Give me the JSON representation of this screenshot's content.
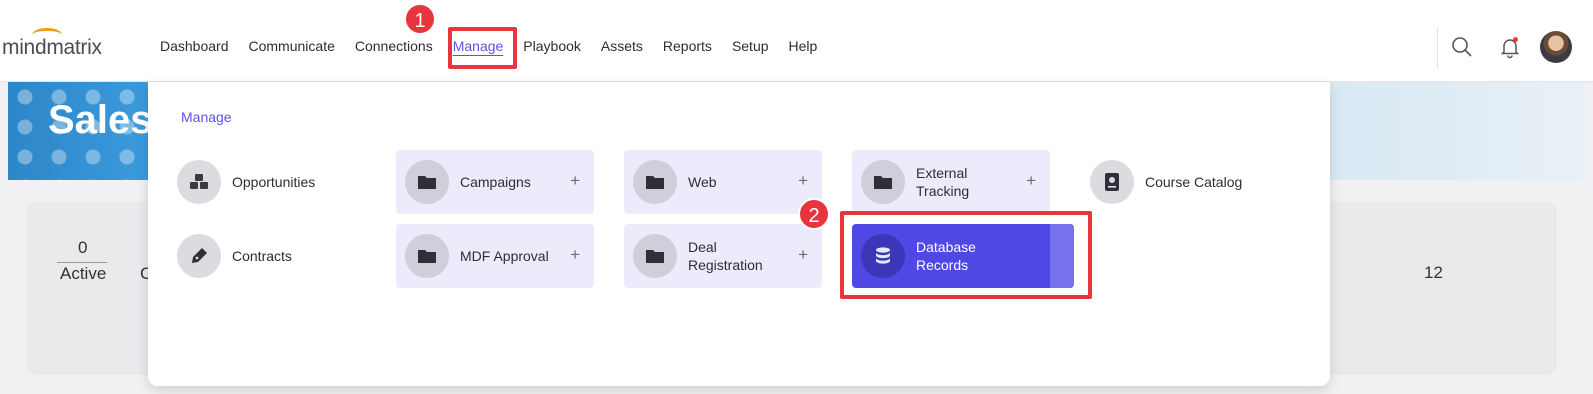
{
  "app": {
    "logo_text": "mindmatrix"
  },
  "nav": {
    "items": [
      {
        "label": "Dashboard"
      },
      {
        "label": "Communicate"
      },
      {
        "label": "Connections"
      },
      {
        "label": "Manage",
        "active": true
      },
      {
        "label": "Playbook"
      },
      {
        "label": "Assets"
      },
      {
        "label": "Reports"
      },
      {
        "label": "Setup"
      },
      {
        "label": "Help"
      }
    ]
  },
  "header_icons": [
    "search-icon",
    "bell-icon",
    "user-avatar"
  ],
  "annotations": {
    "step1": "1",
    "step2": "2"
  },
  "banner": {
    "title": "Sales"
  },
  "stats": {
    "active_count": "0",
    "active_label": "Active",
    "partial_label": "C",
    "right_count": "12"
  },
  "menu": {
    "title": "Manage",
    "items": [
      {
        "label_line1": "Opportunities",
        "label_line2": "",
        "icon": "cubes-icon",
        "style": "plain",
        "has_plus": false
      },
      {
        "label_line1": "Campaigns",
        "label_line2": "",
        "icon": "folder-icon",
        "style": "filled",
        "has_plus": true
      },
      {
        "label_line1": "Web",
        "label_line2": "",
        "icon": "folder-icon",
        "style": "filled",
        "has_plus": true
      },
      {
        "label_line1": "External",
        "label_line2": "Tracking",
        "icon": "folder-icon",
        "style": "filled",
        "has_plus": true
      },
      {
        "label_line1": "Course Catalog",
        "label_line2": "",
        "icon": "book-icon",
        "style": "plain",
        "has_plus": false
      },
      {
        "label_line1": "Contracts",
        "label_line2": "",
        "icon": "pen-icon",
        "style": "plain",
        "has_plus": false
      },
      {
        "label_line1": "MDF Approval",
        "label_line2": "",
        "icon": "folder-icon",
        "style": "filled",
        "has_plus": true
      },
      {
        "label_line1": "Deal",
        "label_line2": "Registration",
        "icon": "folder-icon",
        "style": "filled",
        "has_plus": true
      },
      {
        "label_line1": "Database",
        "label_line2": "Records",
        "icon": "database-icon",
        "style": "selected",
        "has_plus": false
      }
    ],
    "plus_symbol": "+"
  },
  "colors": {
    "accent": "#5a54e6",
    "selected_tile": "#5048e5",
    "annotation_red": "#e8343c"
  }
}
